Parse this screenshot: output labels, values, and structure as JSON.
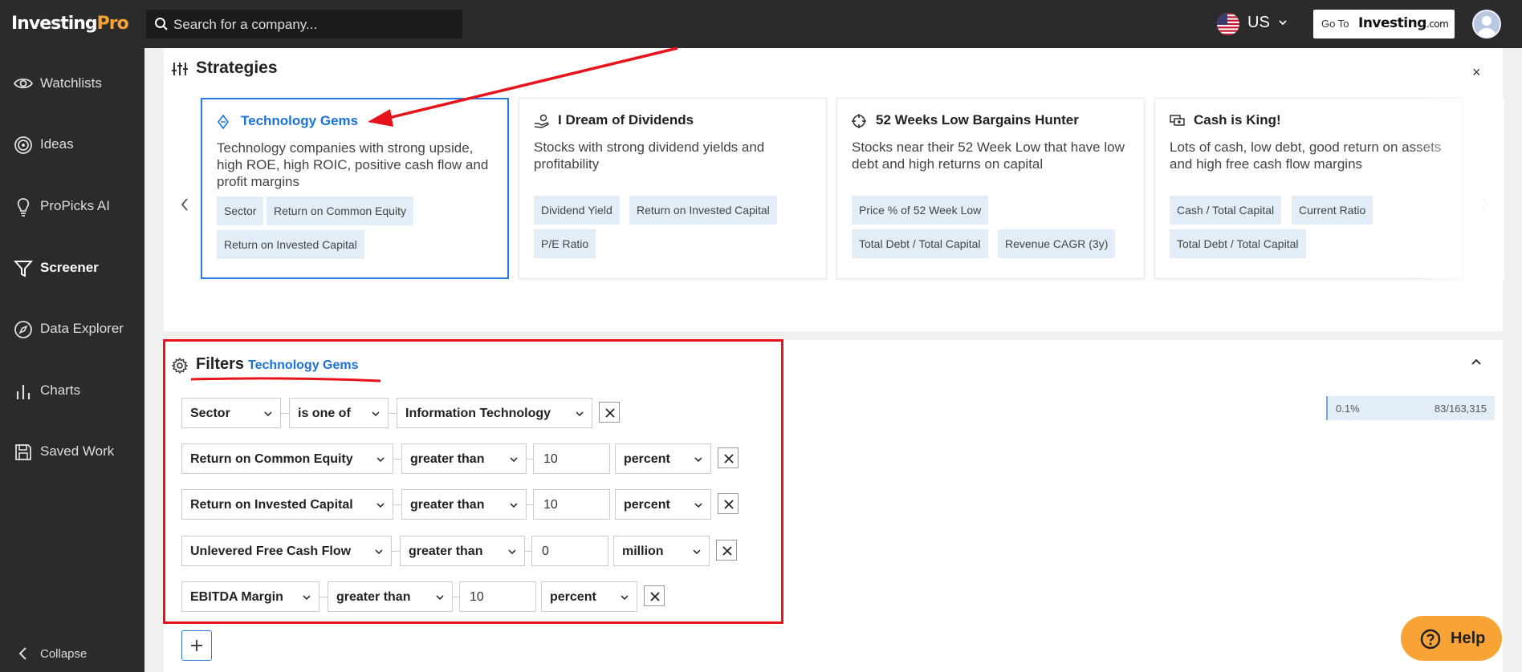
{
  "header": {
    "logo_main": "Investing",
    "logo_accent": "Pro",
    "search_placeholder": "Search for a company...",
    "region": "US",
    "goto_small": "Go To",
    "goto_brand": "Investing",
    "goto_suffix": ".com"
  },
  "sidebar": {
    "items": [
      {
        "label": "Watchlists",
        "icon": "eye-icon"
      },
      {
        "label": "Ideas",
        "icon": "target-icon"
      },
      {
        "label": "ProPicks AI",
        "icon": "bulb-icon"
      },
      {
        "label": "Screener",
        "icon": "filter-icon",
        "active": true
      },
      {
        "label": "Data Explorer",
        "icon": "compass-icon"
      },
      {
        "label": "Charts",
        "icon": "bar-chart-icon"
      },
      {
        "label": "Saved Work",
        "icon": "save-icon"
      }
    ],
    "collapse_label": "Collapse"
  },
  "strategies": {
    "title": "Strategies",
    "close": "×",
    "cards": [
      {
        "title": "Technology Gems",
        "icon": "gem-icon",
        "selected": true,
        "description": "Technology companies with strong upside, high ROE, high ROIC, positive cash flow and profit margins",
        "chips": [
          "Sector",
          "Return on Common Equity",
          "Return on Invested Capital"
        ]
      },
      {
        "title": "I Dream of Dividends",
        "icon": "coins-hand-icon",
        "description": "Stocks with strong dividend yields and profitability",
        "chips": [
          "Dividend Yield",
          "Return on Invested Capital",
          "P/E Ratio"
        ]
      },
      {
        "title": "52 Weeks Low Bargains Hunter",
        "icon": "crosshair-icon",
        "description": "Stocks near their 52 Week Low that have low debt and high returns on capital",
        "chips": [
          "Price % of 52 Week Low",
          "Total Debt / Total Capital",
          "Revenue CAGR (3y)"
        ]
      },
      {
        "title": "Cash is King!",
        "icon": "cash-icon",
        "description": "Lots of cash, low debt, good return on assets and high free cash flow margins",
        "chips": [
          "Cash / Total Capital",
          "Current Ratio",
          "Total Debt / Total Capital"
        ]
      }
    ]
  },
  "filters": {
    "title": "Filters",
    "strategy_name": "Technology Gems",
    "match_pct": "0.1%",
    "match_count": "83/163,315",
    "rows": [
      {
        "metric": "Sector",
        "operator": "is one of",
        "value": "Information Technology"
      },
      {
        "metric": "Return on Common Equity",
        "operator": "greater than",
        "value": "10",
        "unit": "percent"
      },
      {
        "metric": "Return on Invested Capital",
        "operator": "greater than",
        "value": "10",
        "unit": "percent"
      },
      {
        "metric": "Unlevered Free Cash Flow",
        "operator": "greater than",
        "value": "0",
        "unit": "million"
      },
      {
        "metric": "EBITDA Margin",
        "operator": "greater than",
        "value": "10",
        "unit": "percent"
      }
    ]
  },
  "help": {
    "label": "Help"
  },
  "colors": {
    "accent": "#1a72d8",
    "brand_orange": "#f7a336",
    "annotation_red": "#e8121b",
    "chip_bg": "#e3edf8"
  }
}
